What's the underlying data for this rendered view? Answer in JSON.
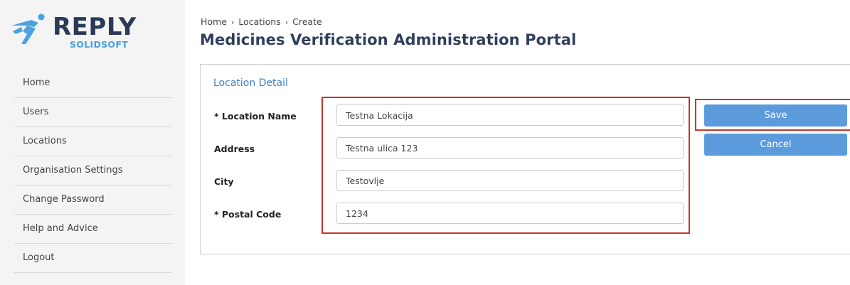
{
  "brand": {
    "name": "REPLY",
    "sub": "SOLIDSOFT",
    "colors": {
      "primary": "#2a3a56",
      "accent": "#4aa3df"
    }
  },
  "sidebar": {
    "items": [
      {
        "label": "Home"
      },
      {
        "label": "Users"
      },
      {
        "label": "Locations"
      },
      {
        "label": "Organisation Settings"
      },
      {
        "label": "Change Password"
      },
      {
        "label": "Help and Advice"
      },
      {
        "label": "Logout"
      }
    ]
  },
  "breadcrumb": {
    "items": [
      "Home",
      "Locations",
      "Create"
    ],
    "separator": "›"
  },
  "page": {
    "title": "Medicines Verification Administration Portal"
  },
  "form": {
    "section_title": "Location Detail",
    "fields": [
      {
        "label": "* Location Name",
        "value": "Testna Lokacija"
      },
      {
        "label": "Address",
        "value": "Testna ulica 123"
      },
      {
        "label": "City",
        "value": "Testovlje"
      },
      {
        "label": "* Postal Code",
        "value": "1234"
      }
    ]
  },
  "actions": {
    "save_label": "Save",
    "cancel_label": "Cancel"
  },
  "colors": {
    "button": "#5b9bdc",
    "highlight": "#c0392b",
    "section_title": "#3d7fc1"
  }
}
